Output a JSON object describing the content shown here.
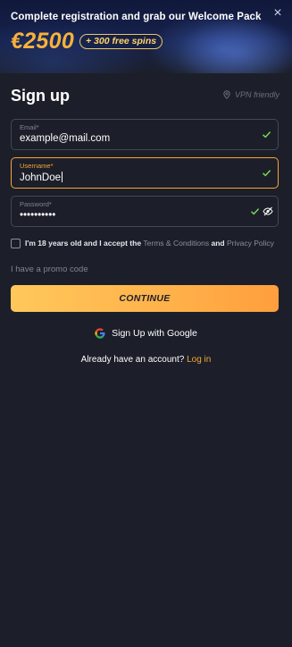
{
  "banner": {
    "title": "Complete registration and grab our Welcome Pack",
    "amount": "€2500",
    "spins_badge": "+ 300 free spins"
  },
  "heading": "Sign up",
  "vpn_label": "VPN friendly",
  "fields": {
    "email": {
      "label": "Email*",
      "value": "example@mail.com"
    },
    "username": {
      "label": "Username*",
      "value": "JohnDoe"
    },
    "password": {
      "label": "Password*",
      "value": "••••••••••"
    }
  },
  "terms": {
    "prefix": "I'm 18 years old and I accept the",
    "terms_link": "Terms & Conditions",
    "and": "and",
    "privacy_link": "Privacy Policy"
  },
  "promo_label": "I have a promo code",
  "continue_label": "CONTINUE",
  "google_label": "Sign Up with Google",
  "login": {
    "prompt": "Already have an account?",
    "link": "Log in"
  },
  "colors": {
    "accent": "#f4a53a",
    "valid": "#7ed957",
    "background": "#1c1f29"
  }
}
